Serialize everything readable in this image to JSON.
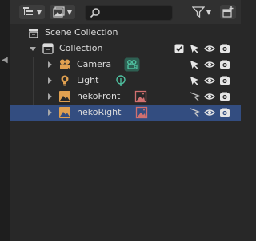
{
  "header": {
    "display_mode_icon": "outliner-icon",
    "filter_icon": "filter-funnel-icon",
    "new_collection_icon": "new-collection-icon",
    "search": {
      "value": "",
      "placeholder": ""
    }
  },
  "tree": {
    "scene_collection": {
      "label": "Scene Collection"
    },
    "collection": {
      "label": "Collection"
    },
    "objects": [
      {
        "label": "Camera",
        "type": "camera",
        "data_icon": "camera-data-icon",
        "selectable": true,
        "selected": false
      },
      {
        "label": "Light",
        "type": "light",
        "data_icon": "light-data-icon",
        "selectable": true,
        "selected": false
      },
      {
        "label": "nekoFront",
        "type": "image",
        "data_icon": "image-data-icon",
        "selectable": false,
        "selected": false
      },
      {
        "label": "nekoRight",
        "type": "image",
        "data_icon": "image-data-icon",
        "selectable": false,
        "selected": true
      }
    ]
  },
  "colors": {
    "background": "#282828",
    "header": "#303030",
    "selection": "#334d80",
    "camera_accent": "#e0a050",
    "data_green": "#4fc0a0",
    "image_accent": "#d07070"
  }
}
